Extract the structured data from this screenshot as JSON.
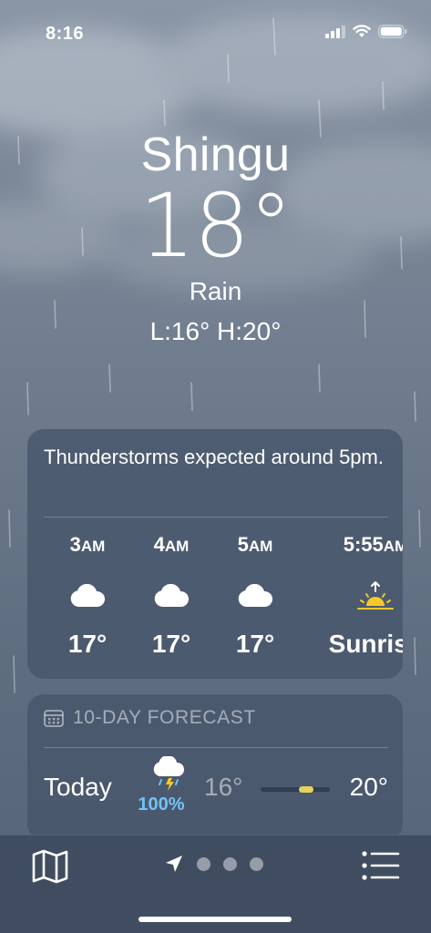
{
  "status_bar": {
    "time": "8:16"
  },
  "location": {
    "city": "Shingu",
    "temperature": "18°",
    "condition": "Rain",
    "hi_lo": "L:16° H:20°"
  },
  "hourly_card": {
    "alert": "Thunderstorms expected around 5pm.",
    "hours": [
      {
        "hour": "3",
        "ampm": "AM",
        "icon": "cloud-icon",
        "temp": "17°"
      },
      {
        "hour": "4",
        "ampm": "AM",
        "icon": "cloud-icon",
        "temp": "17°"
      },
      {
        "hour": "5",
        "ampm": "AM",
        "icon": "cloud-icon",
        "temp": "17°"
      },
      {
        "hour": "5:55",
        "ampm": "AM",
        "icon": "sunrise-icon",
        "temp": "Sunrise"
      }
    ]
  },
  "forecast_card": {
    "header": "10-DAY FORECAST",
    "days": [
      {
        "day": "Today",
        "icon": "thunderstorm-icon",
        "precip": "100%",
        "low": "16°",
        "high": "20°"
      }
    ]
  },
  "colors": {
    "precip_text": "#72c3f7",
    "sun_yellow": "#f5c928",
    "card_bg": "#46556a"
  }
}
